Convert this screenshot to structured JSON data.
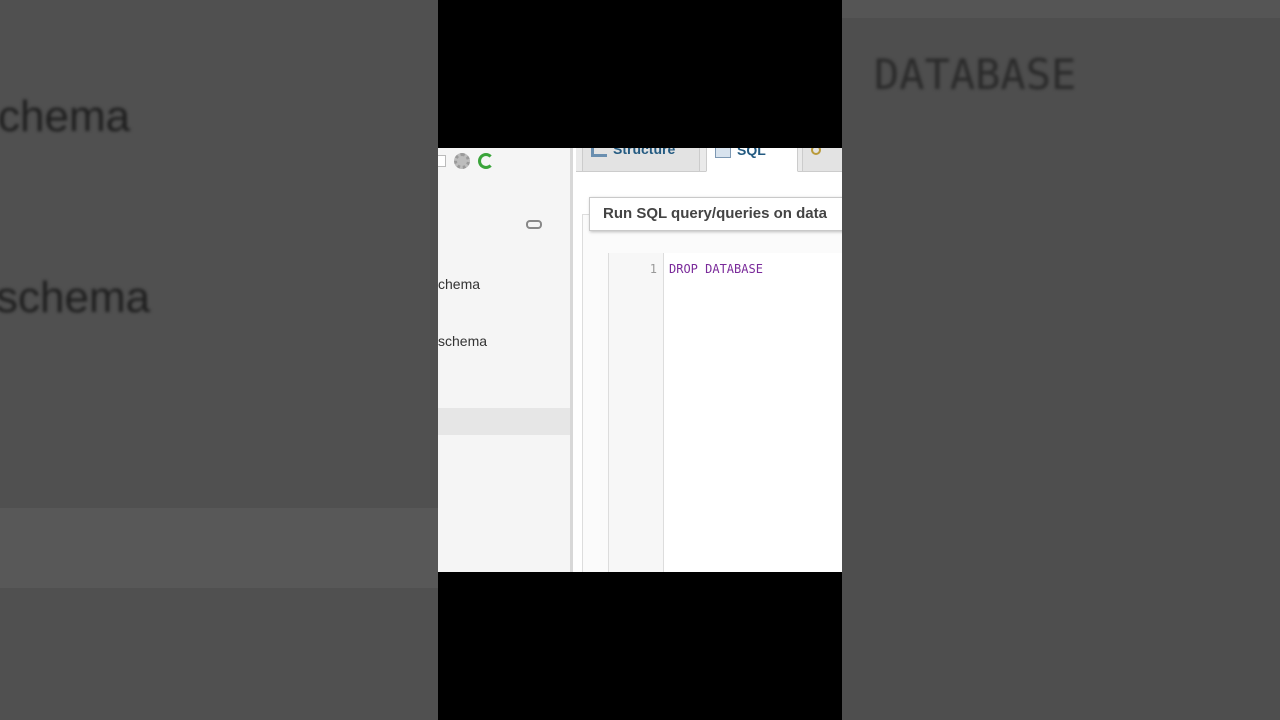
{
  "background": {
    "left_items": [
      "chema",
      "schema"
    ],
    "right_text": "DATABASE"
  },
  "navigation": {
    "items": [
      "chema",
      "schema"
    ],
    "icons": [
      "checkbox-icon",
      "gear-icon",
      "reload-icon",
      "link-icon"
    ]
  },
  "tabs": [
    {
      "label": "Structure",
      "icon": "structure-icon"
    },
    {
      "label": "SQL",
      "icon": "sql-icon",
      "active": true
    },
    {
      "label": "",
      "icon": "search-icon"
    }
  ],
  "sql_panel": {
    "legend": "Run SQL query/queries on data"
  },
  "editor": {
    "line_number": "1",
    "code": "DROP DATABASE"
  },
  "colors": {
    "tab_text": "#235a81",
    "code_keyword": "#7a2a9a",
    "reload_green": "#3aa43a"
  }
}
